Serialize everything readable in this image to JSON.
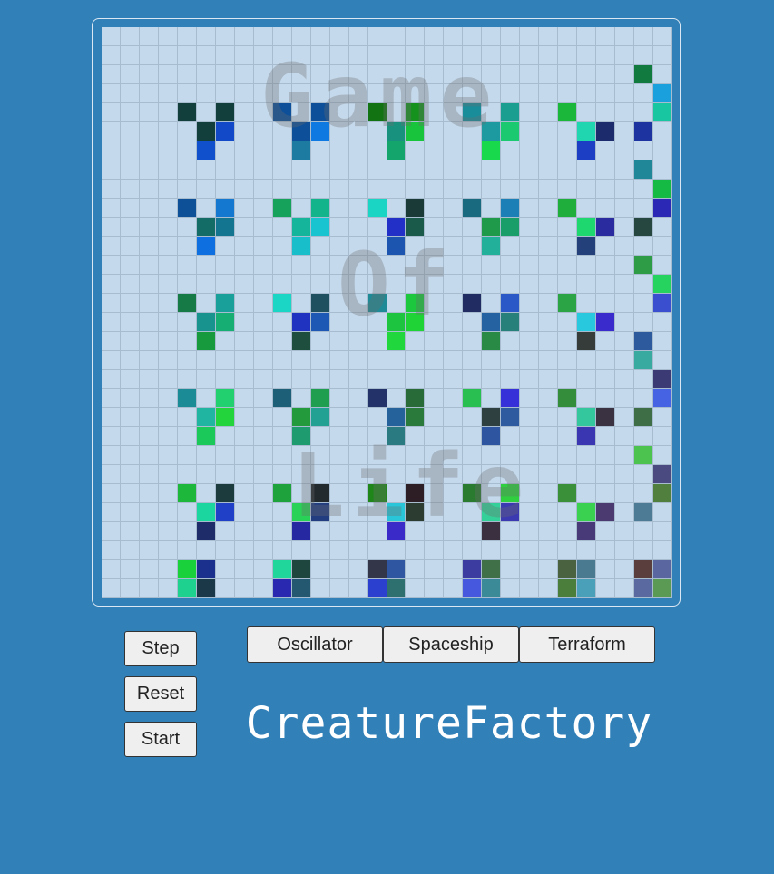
{
  "board": {
    "rows": 30,
    "cols": 30,
    "watermark_lines": [
      "Game",
      "Of",
      "Life"
    ],
    "live_cells": [
      [
        2,
        28,
        "#107a3f"
      ],
      [
        3,
        29,
        "#1aa1dd"
      ],
      [
        4,
        29,
        "#19c6a2"
      ],
      [
        7,
        28,
        "#1f8797"
      ],
      [
        8,
        29,
        "#14ba43"
      ],
      [
        9,
        29,
        "#2b28b6"
      ],
      [
        10,
        28,
        "#264740"
      ],
      [
        12,
        28,
        "#2e9c46"
      ],
      [
        13,
        29,
        "#25d35e"
      ],
      [
        14,
        29,
        "#3a4fcf"
      ],
      [
        16,
        28,
        "#2c5a9c"
      ],
      [
        17,
        28,
        "#39aaa0"
      ],
      [
        18,
        29,
        "#3c3a74"
      ],
      [
        19,
        29,
        "#4663e3"
      ],
      [
        20,
        28,
        "#3d6e45"
      ],
      [
        22,
        28,
        "#4cc34f"
      ],
      [
        23,
        29,
        "#4a4a80"
      ],
      [
        24,
        29,
        "#51803e"
      ],
      [
        25,
        28,
        "#4d7b95"
      ],
      [
        28,
        28,
        "#5a3d3d"
      ],
      [
        28,
        29,
        "#5a66a0"
      ],
      [
        29,
        28,
        "#5a6aa0"
      ],
      [
        29,
        29,
        "#5a9a55"
      ],
      [
        4,
        4,
        "#123e3c"
      ],
      [
        4,
        6,
        "#123e3c"
      ],
      [
        5,
        5,
        "#123e3c"
      ],
      [
        5,
        6,
        "#1149c9"
      ],
      [
        6,
        5,
        "#1150cc"
      ],
      [
        4,
        9,
        "#0d4f98"
      ],
      [
        4,
        11,
        "#0d4f98"
      ],
      [
        5,
        10,
        "#0d4f98"
      ],
      [
        5,
        11,
        "#0e79e0"
      ],
      [
        6,
        10,
        "#1d7aa1"
      ],
      [
        4,
        14,
        "#127312"
      ],
      [
        4,
        16,
        "#15921e"
      ],
      [
        5,
        15,
        "#18927f"
      ],
      [
        5,
        16,
        "#17c43b"
      ],
      [
        6,
        15,
        "#13a56b"
      ],
      [
        4,
        19,
        "#1a8d9a"
      ],
      [
        4,
        21,
        "#1a9e90"
      ],
      [
        5,
        20,
        "#1d9a9f"
      ],
      [
        5,
        21,
        "#1ac970"
      ],
      [
        6,
        20,
        "#17d94b"
      ],
      [
        4,
        24,
        "#1ab73a"
      ],
      [
        5,
        25,
        "#20d6b0"
      ],
      [
        5,
        26,
        "#1c2b6c"
      ],
      [
        6,
        25,
        "#1c3ec4"
      ],
      [
        5,
        28,
        "#1d33a0"
      ],
      [
        9,
        4,
        "#0d5097"
      ],
      [
        9,
        6,
        "#1477d0"
      ],
      [
        10,
        5,
        "#136c66"
      ],
      [
        10,
        6,
        "#147591"
      ],
      [
        11,
        5,
        "#0e70e0"
      ],
      [
        9,
        9,
        "#16a25b"
      ],
      [
        9,
        11,
        "#13b48b"
      ],
      [
        10,
        10,
        "#14b59a"
      ],
      [
        10,
        11,
        "#17c4d0"
      ],
      [
        11,
        10,
        "#18bfcb"
      ],
      [
        9,
        14,
        "#1bd5c4"
      ],
      [
        9,
        16,
        "#1a3a37"
      ],
      [
        10,
        15,
        "#2330c8"
      ],
      [
        10,
        16,
        "#1a5a4a"
      ],
      [
        11,
        15,
        "#1c55b0"
      ],
      [
        9,
        19,
        "#1a6a7f"
      ],
      [
        9,
        21,
        "#1c80b6"
      ],
      [
        10,
        20,
        "#1e9a4a"
      ],
      [
        10,
        21,
        "#1a9e69"
      ],
      [
        11,
        20,
        "#22b09a"
      ],
      [
        9,
        24,
        "#1fad3c"
      ],
      [
        10,
        25,
        "#1ed76e"
      ],
      [
        10,
        26,
        "#2b2ba0"
      ],
      [
        11,
        25,
        "#23407a"
      ],
      [
        14,
        4,
        "#157a45"
      ],
      [
        14,
        6,
        "#1aa09a"
      ],
      [
        15,
        5,
        "#19938e"
      ],
      [
        15,
        6,
        "#17ae73"
      ],
      [
        16,
        5,
        "#179a3e"
      ],
      [
        14,
        9,
        "#1cd6c5"
      ],
      [
        14,
        11,
        "#1e5060"
      ],
      [
        15,
        10,
        "#2033c0"
      ],
      [
        15,
        11,
        "#1e58b5"
      ],
      [
        16,
        10,
        "#1e4e3e"
      ],
      [
        14,
        14,
        "#1e8a96"
      ],
      [
        14,
        16,
        "#1bc83e"
      ],
      [
        15,
        15,
        "#1dc43f"
      ],
      [
        15,
        16,
        "#1fd336"
      ],
      [
        16,
        15,
        "#20d83d"
      ],
      [
        14,
        19,
        "#202c62"
      ],
      [
        14,
        21,
        "#2a58c6"
      ],
      [
        15,
        20,
        "#2462a2"
      ],
      [
        15,
        21,
        "#27807a"
      ],
      [
        16,
        20,
        "#288a44"
      ],
      [
        14,
        24,
        "#2aa444"
      ],
      [
        15,
        25,
        "#28c8de"
      ],
      [
        15,
        26,
        "#3a2bcc"
      ],
      [
        16,
        25,
        "#363c3a"
      ],
      [
        19,
        4,
        "#1b8c95"
      ],
      [
        19,
        6,
        "#22d06f"
      ],
      [
        20,
        5,
        "#1fb5a0"
      ],
      [
        20,
        6,
        "#24d43d"
      ],
      [
        21,
        5,
        "#1bc85a"
      ],
      [
        19,
        9,
        "#1e5f78"
      ],
      [
        19,
        11,
        "#209e50"
      ],
      [
        20,
        10,
        "#239a3c"
      ],
      [
        20,
        11,
        "#23a294"
      ],
      [
        21,
        10,
        "#1e9b6f"
      ],
      [
        19,
        14,
        "#24326a"
      ],
      [
        19,
        16,
        "#286a38"
      ],
      [
        20,
        15,
        "#25629c"
      ],
      [
        20,
        16,
        "#2a7a3c"
      ],
      [
        21,
        15,
        "#2a7a82"
      ],
      [
        19,
        19,
        "#2ac051"
      ],
      [
        19,
        21,
        "#3530d8"
      ],
      [
        20,
        20,
        "#2e4040"
      ],
      [
        20,
        21,
        "#2e5aa0"
      ],
      [
        21,
        20,
        "#2e56a0"
      ],
      [
        19,
        24,
        "#338d3a"
      ],
      [
        20,
        25,
        "#34c79e"
      ],
      [
        20,
        26,
        "#3a3240"
      ],
      [
        21,
        25,
        "#3a35b0"
      ],
      [
        24,
        4,
        "#1cb73b"
      ],
      [
        24,
        6,
        "#1c3b3c"
      ],
      [
        25,
        5,
        "#1cd6a0"
      ],
      [
        25,
        6,
        "#2040c8"
      ],
      [
        26,
        5,
        "#1e2c6a"
      ],
      [
        24,
        9,
        "#1ea23c"
      ],
      [
        24,
        11,
        "#232a2e"
      ],
      [
        25,
        10,
        "#28d256"
      ],
      [
        25,
        11,
        "#223d80"
      ],
      [
        26,
        10,
        "#2528a0"
      ],
      [
        24,
        14,
        "#1f861a"
      ],
      [
        24,
        16,
        "#2c1e24"
      ],
      [
        25,
        15,
        "#28c6d8"
      ],
      [
        25,
        16,
        "#2c3c30"
      ],
      [
        26,
        15,
        "#3a2ac8"
      ],
      [
        24,
        19,
        "#2a7a30"
      ],
      [
        24,
        21,
        "#2fcf3f"
      ],
      [
        25,
        20,
        "#34d09a"
      ],
      [
        25,
        21,
        "#3b3ab0"
      ],
      [
        26,
        20,
        "#3a3040"
      ],
      [
        24,
        24,
        "#3a9038"
      ],
      [
        25,
        25,
        "#3ad050"
      ],
      [
        25,
        26,
        "#4a3a70"
      ],
      [
        26,
        25,
        "#483a78"
      ],
      [
        28,
        4,
        "#19d13a"
      ],
      [
        28,
        5,
        "#1b2f8c"
      ],
      [
        29,
        4,
        "#1ed18e"
      ],
      [
        29,
        5,
        "#1b3848"
      ],
      [
        28,
        9,
        "#20d69a"
      ],
      [
        28,
        10,
        "#1e463e"
      ],
      [
        29,
        9,
        "#2828b0"
      ],
      [
        29,
        10,
        "#245870"
      ],
      [
        28,
        14,
        "#333648"
      ],
      [
        28,
        15,
        "#2f56a0"
      ],
      [
        29,
        14,
        "#2c40d0"
      ],
      [
        29,
        15,
        "#2e7070"
      ],
      [
        28,
        19,
        "#3c3ca0"
      ],
      [
        28,
        20,
        "#3f7048"
      ],
      [
        29,
        19,
        "#4558de"
      ],
      [
        29,
        20,
        "#3a8a98"
      ],
      [
        28,
        24,
        "#4a6240"
      ],
      [
        28,
        25,
        "#4a7a90"
      ],
      [
        29,
        24,
        "#4a7e3a"
      ],
      [
        29,
        25,
        "#4aa0b8"
      ]
    ]
  },
  "controls": {
    "step": "Step",
    "reset": "Reset",
    "start": "Start",
    "oscillator": "Oscillator",
    "spaceship": "Spaceship",
    "terraform": "Terraform"
  },
  "app_title": "CreatureFactory"
}
